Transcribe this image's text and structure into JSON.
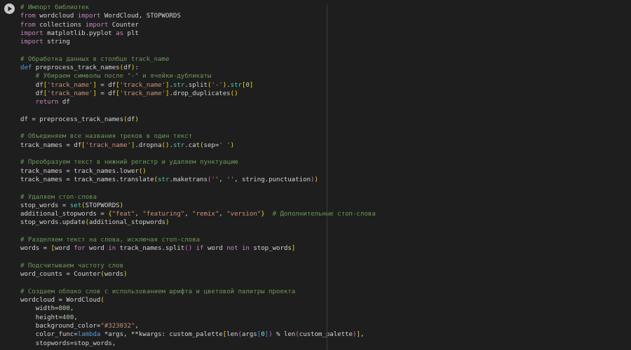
{
  "cell": {
    "run_button": "run-cell",
    "lines": [
      [
        [
          "c",
          "# Импорт библиотек"
        ]
      ],
      [
        [
          "k",
          "from"
        ],
        [
          "p",
          " wordcloud "
        ],
        [
          "k",
          "import"
        ],
        [
          "p",
          " WordCloud, STOPWORDS"
        ]
      ],
      [
        [
          "k",
          "from"
        ],
        [
          "p",
          " collections "
        ],
        [
          "k",
          "import"
        ],
        [
          "p",
          " Counter"
        ]
      ],
      [
        [
          "k",
          "import"
        ],
        [
          "p",
          " matplotlib.pyplot "
        ],
        [
          "k",
          "as"
        ],
        [
          "p",
          " plt"
        ]
      ],
      [
        [
          "k",
          "import"
        ],
        [
          "p",
          " string"
        ]
      ],
      [],
      [
        [
          "c",
          "# Обработка данных в столбце track_name"
        ]
      ],
      [
        [
          "d",
          "def"
        ],
        [
          "p",
          " preprocess_track_names"
        ],
        [
          "b1",
          "("
        ],
        [
          "p",
          "df"
        ],
        [
          "b1",
          ")"
        ],
        [
          "p",
          ":"
        ]
      ],
      [
        [
          "p",
          "    "
        ],
        [
          "c",
          "# Убираем символы после \"-\" и ячейки-дубликаты"
        ]
      ],
      [
        [
          "p",
          "    df"
        ],
        [
          "b1",
          "["
        ],
        [
          "s",
          "'track_name'"
        ],
        [
          "b1",
          "]"
        ],
        [
          "p",
          " = df"
        ],
        [
          "b1",
          "["
        ],
        [
          "s",
          "'track_name'"
        ],
        [
          "b1",
          "]"
        ],
        [
          "p",
          "."
        ],
        [
          "t",
          "str"
        ],
        [
          "p",
          ".split"
        ],
        [
          "b1",
          "("
        ],
        [
          "s",
          "'-'"
        ],
        [
          "b1",
          ")"
        ],
        [
          "p",
          "."
        ],
        [
          "t",
          "str"
        ],
        [
          "b1",
          "["
        ],
        [
          "n",
          "0"
        ],
        [
          "b1",
          "]"
        ]
      ],
      [
        [
          "p",
          "    df"
        ],
        [
          "b1",
          "["
        ],
        [
          "s",
          "'track_name'"
        ],
        [
          "b1",
          "]"
        ],
        [
          "p",
          " = df"
        ],
        [
          "b1",
          "["
        ],
        [
          "s",
          "'track_name'"
        ],
        [
          "b1",
          "]"
        ],
        [
          "p",
          ".drop_duplicates"
        ],
        [
          "b1",
          "()"
        ]
      ],
      [
        [
          "p",
          "    "
        ],
        [
          "k",
          "return"
        ],
        [
          "p",
          " df"
        ]
      ],
      [],
      [
        [
          "p",
          "df = preprocess_track_names"
        ],
        [
          "b1",
          "("
        ],
        [
          "p",
          "df"
        ],
        [
          "b1",
          ")"
        ]
      ],
      [],
      [
        [
          "c",
          "# Объединяем все названия треков в один текст"
        ]
      ],
      [
        [
          "p",
          "track_names = df"
        ],
        [
          "b1",
          "["
        ],
        [
          "s",
          "'track_name'"
        ],
        [
          "b1",
          "]"
        ],
        [
          "p",
          ".dropna"
        ],
        [
          "b1",
          "()"
        ],
        [
          "p",
          "."
        ],
        [
          "t",
          "str"
        ],
        [
          "p",
          ".cat"
        ],
        [
          "b1",
          "("
        ],
        [
          "p",
          "sep="
        ],
        [
          "s",
          "' '"
        ],
        [
          "b1",
          ")"
        ]
      ],
      [],
      [
        [
          "c",
          "# Преобразуем текст в нижний регистр и удаляем пунктуацию"
        ]
      ],
      [
        [
          "p",
          "track_names = track_names.lower"
        ],
        [
          "b1",
          "()"
        ]
      ],
      [
        [
          "p",
          "track_names = track_names.translate"
        ],
        [
          "b1",
          "("
        ],
        [
          "t",
          "str"
        ],
        [
          "p",
          ".maketrans"
        ],
        [
          "b2",
          "("
        ],
        [
          "s",
          "''"
        ],
        [
          "p",
          ", "
        ],
        [
          "s",
          "''"
        ],
        [
          "p",
          ", string.punctuation"
        ],
        [
          "b2",
          ")"
        ],
        [
          "b1",
          ")"
        ]
      ],
      [],
      [
        [
          "c",
          "# Удаляем стоп-слова"
        ]
      ],
      [
        [
          "p",
          "stop_words = "
        ],
        [
          "t",
          "set"
        ],
        [
          "b1",
          "("
        ],
        [
          "p",
          "STOPWORDS"
        ],
        [
          "b1",
          ")"
        ]
      ],
      [
        [
          "p",
          "additional_stopwords = "
        ],
        [
          "b1",
          "{"
        ],
        [
          "s",
          "\"feat\""
        ],
        [
          "p",
          ", "
        ],
        [
          "s",
          "\"featuring\""
        ],
        [
          "p",
          ", "
        ],
        [
          "s",
          "\"remix\""
        ],
        [
          "p",
          ", "
        ],
        [
          "s",
          "\"version\""
        ],
        [
          "b1",
          "}"
        ],
        [
          "p",
          "  "
        ],
        [
          "c",
          "# Дополнительные стоп-слова"
        ]
      ],
      [
        [
          "p",
          "stop_words.update"
        ],
        [
          "b1",
          "("
        ],
        [
          "p",
          "additional_stopwords"
        ],
        [
          "b1",
          ")"
        ]
      ],
      [],
      [
        [
          "c",
          "# Разделяем текст на слова, исключая стоп-слова"
        ]
      ],
      [
        [
          "p",
          "words = "
        ],
        [
          "b1",
          "["
        ],
        [
          "p",
          "word "
        ],
        [
          "k",
          "for"
        ],
        [
          "p",
          " word "
        ],
        [
          "k",
          "in"
        ],
        [
          "p",
          " track_names.split"
        ],
        [
          "b2",
          "()"
        ],
        [
          "p",
          " "
        ],
        [
          "k",
          "if"
        ],
        [
          "p",
          " word "
        ],
        [
          "k",
          "not in"
        ],
        [
          "p",
          " stop_words"
        ],
        [
          "b1",
          "]"
        ]
      ],
      [],
      [
        [
          "c",
          "# Подсчитываем частоту слов"
        ]
      ],
      [
        [
          "p",
          "word_counts = Counter"
        ],
        [
          "b1",
          "("
        ],
        [
          "p",
          "words"
        ],
        [
          "b1",
          ")"
        ]
      ],
      [],
      [
        [
          "c",
          "# Создаем облако слов с использованием шрифта и цветовой палитры проекта"
        ]
      ],
      [
        [
          "p",
          "wordcloud = WordCloud"
        ],
        [
          "b1",
          "("
        ]
      ],
      [
        [
          "p",
          "    width="
        ],
        [
          "n",
          "800"
        ],
        [
          "p",
          ","
        ]
      ],
      [
        [
          "p",
          "    height="
        ],
        [
          "n",
          "400"
        ],
        [
          "p",
          ","
        ]
      ],
      [
        [
          "p",
          "    background_color="
        ],
        [
          "s",
          "\"#323032\""
        ],
        [
          "p",
          ","
        ]
      ],
      [
        [
          "p",
          "    color_func="
        ],
        [
          "d",
          "lambda"
        ],
        [
          "p",
          " *args, **kwargs: custom_palette"
        ],
        [
          "b1",
          "["
        ],
        [
          "p",
          "len"
        ],
        [
          "b2",
          "("
        ],
        [
          "p",
          "args"
        ],
        [
          "b3",
          "["
        ],
        [
          "n",
          "0"
        ],
        [
          "b3",
          "]"
        ],
        [
          "b2",
          ")"
        ],
        [
          "p",
          " % len"
        ],
        [
          "b2",
          "("
        ],
        [
          "p",
          "custom_palette"
        ],
        [
          "b2",
          ")"
        ],
        [
          "b1",
          "]"
        ],
        [
          "p",
          ","
        ]
      ],
      [
        [
          "p",
          "    stopwords=stop_words,"
        ]
      ]
    ]
  }
}
